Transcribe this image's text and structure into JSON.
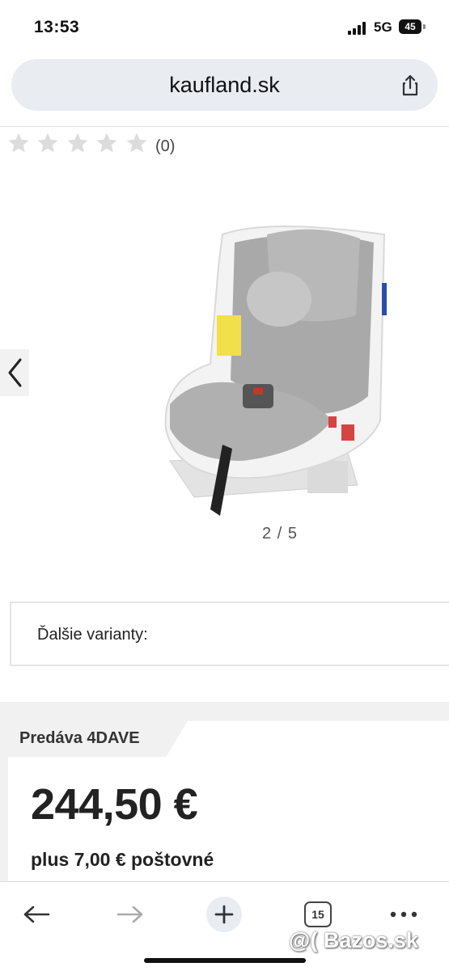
{
  "status": {
    "time": "13:53",
    "network": "5G",
    "battery": "45"
  },
  "browser": {
    "url": "kaufland.sk",
    "tab_count": "15"
  },
  "rating": {
    "stars": 0,
    "max": 5,
    "count_text": "(0)"
  },
  "gallery": {
    "counter": "2 / 5"
  },
  "variants": {
    "label": "Ďalšie varianty:"
  },
  "seller": {
    "label": "Predáva 4DAVE"
  },
  "product": {
    "price": "244,50 €",
    "shipping": "plus 7,00 € poštovné"
  },
  "watermark": "@( Bazos.sk",
  "colors": {
    "url_bar": "#e9ecf1",
    "star_empty": "#dcdcdc",
    "seller_bg": "#f1f1f1"
  }
}
